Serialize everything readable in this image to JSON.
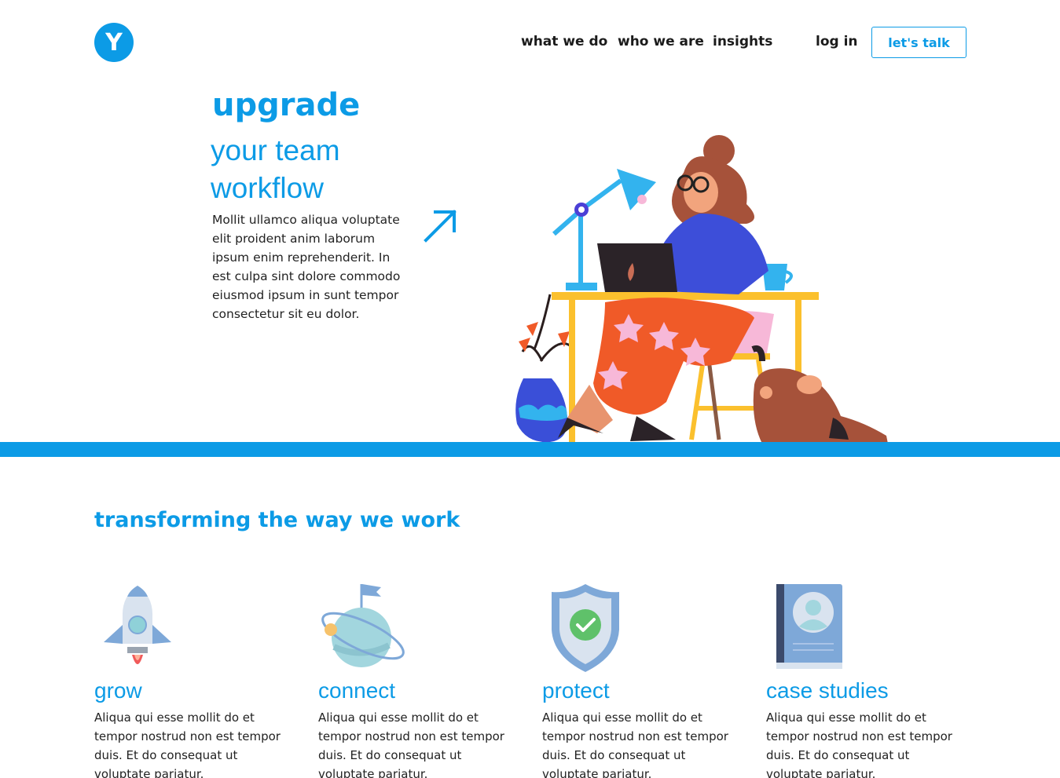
{
  "brand": {
    "logo_letter": "Y"
  },
  "nav": {
    "items": [
      "what we do",
      "who we are",
      "insights"
    ],
    "login": "log in",
    "cta": "let's talk"
  },
  "hero": {
    "title": "upgrade",
    "subtitle_line1": "your team",
    "subtitle_line2": "workflow",
    "body": "Mollit ullamco aliqua voluptate elit proident anim laborum ipsum enim reprehenderit. In est culpa sint dolore commodo eiusmod ipsum in sunt tempor consectetur sit eu dolor."
  },
  "section": {
    "title": "transforming the way we work"
  },
  "features": [
    {
      "title": "grow",
      "icon": "rocket-icon",
      "body": "Aliqua qui esse mollit do et tempor nostrud non est tempor duis. Et do consequat ut voluptate pariatur."
    },
    {
      "title": "connect",
      "icon": "planet-icon",
      "body": "Aliqua qui esse mollit do et tempor nostrud non est tempor duis. Et do consequat ut voluptate pariatur."
    },
    {
      "title": "protect",
      "icon": "shield-icon",
      "body": "Aliqua qui esse mollit do et tempor nostrud non est tempor duis. Et do consequat ut voluptate pariatur."
    },
    {
      "title": "case studies",
      "icon": "book-icon",
      "body": "Aliqua qui esse mollit do et tempor nostrud non est tempor duis. Et do consequat ut voluptate pariatur."
    }
  ],
  "colors": {
    "accent": "#0c9be6",
    "text": "#222222",
    "background": "#ffffff"
  }
}
